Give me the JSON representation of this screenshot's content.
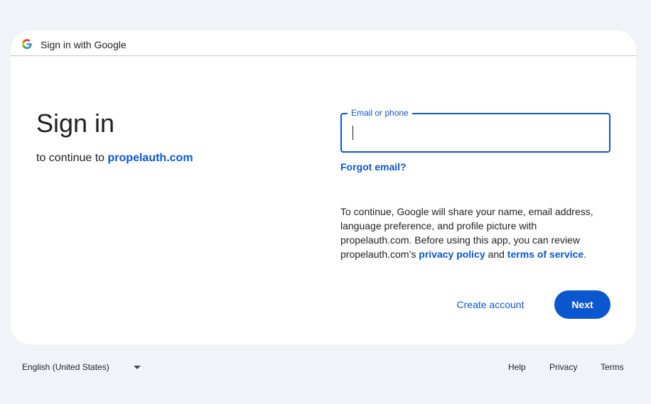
{
  "header": {
    "title": "Sign in with Google",
    "logo_icon": "google-g-icon"
  },
  "main": {
    "title": "Sign in",
    "subtitle_prefix": "to continue to",
    "subtitle_link": "propelauth.com"
  },
  "form": {
    "email_label": "Email or phone",
    "email_value": "",
    "forgot_email": "Forgot email?"
  },
  "info": {
    "text_1": "To continue, Google will share your name, email address, language preference, and profile picture with propelauth.com. Before using this app, you can review propelauth.com’s",
    "privacy_link": "privacy policy",
    "and": "and",
    "terms_link": "terms of service",
    "period": "."
  },
  "actions": {
    "create_account": "Create account",
    "next": "Next"
  },
  "footer": {
    "language": "English (United States)",
    "help": "Help",
    "privacy": "Privacy",
    "terms": "Terms"
  },
  "colors": {
    "accent": "#0b57d0",
    "background": "#f0f4f9",
    "card": "#ffffff"
  }
}
